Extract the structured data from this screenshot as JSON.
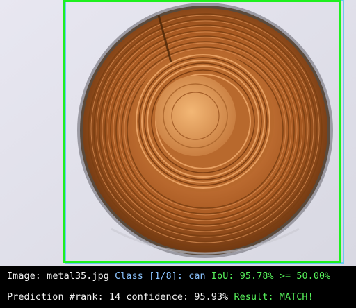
{
  "image_panel": {
    "filename": "metal35.jpg",
    "boxes": {
      "ground_truth_color": "#6ec8f2",
      "prediction_color": "#1ef01e"
    }
  },
  "info_panel": {
    "line1": {
      "image_label": "Image:",
      "image_value": "metal35.jpg",
      "class_label": "Class [1/8]:",
      "class_value": "can",
      "iou_text": "IoU: 95.78% >= 50.00%"
    },
    "line2": {
      "prediction_text": "Prediction #rank: 14 confidence: 95.93%",
      "result_text": "Result: MATCH!"
    }
  },
  "colors": {
    "text_white": "#f4f4f4",
    "class_blue": "#8cc4ff",
    "iou_green": "#56f05a",
    "background": "#000000"
  }
}
